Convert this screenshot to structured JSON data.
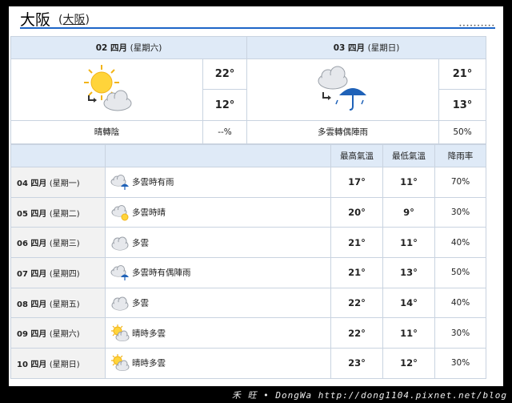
{
  "header": {
    "city": "大阪",
    "sub_open": "(",
    "sub_link": "大阪",
    "sub_close": ")",
    "dots": "••••••••••"
  },
  "days": [
    {
      "date": "02 四月",
      "weekday": "(星期六)",
      "icon": "sun-to-cloud-icon",
      "high": "22°",
      "low": "12°",
      "desc": "晴轉陰",
      "rain": "--%"
    },
    {
      "date": "03 四月",
      "weekday": "(星期日)",
      "icon": "cloud-to-rain-icon",
      "high": "21°",
      "low": "13°",
      "desc": "多雲轉偶陣雨",
      "rain": "50%"
    }
  ],
  "week": {
    "headers": {
      "blank1": "",
      "blank2": "",
      "high": "最高氣溫",
      "low": "最低氣溫",
      "rain": "降雨率"
    },
    "rows": [
      {
        "date": "04 四月",
        "weekday": "(星期一)",
        "icon": "cloud-rain-icon",
        "cond": "多雲時有雨",
        "high": "17°",
        "low": "11°",
        "rain": "70%"
      },
      {
        "date": "05 四月",
        "weekday": "(星期二)",
        "icon": "cloud-sun-icon",
        "cond": "多雲時晴",
        "high": "20°",
        "low": "9°",
        "rain": "30%"
      },
      {
        "date": "06 四月",
        "weekday": "(星期三)",
        "icon": "cloud-icon",
        "cond": "多雲",
        "high": "21°",
        "low": "11°",
        "rain": "40%"
      },
      {
        "date": "07 四月",
        "weekday": "(星期四)",
        "icon": "cloud-rain-icon",
        "cond": "多雲時有偶陣雨",
        "high": "21°",
        "low": "13°",
        "rain": "50%"
      },
      {
        "date": "08 四月",
        "weekday": "(星期五)",
        "icon": "cloud-icon",
        "cond": "多雲",
        "high": "22°",
        "low": "14°",
        "rain": "40%"
      },
      {
        "date": "09 四月",
        "weekday": "(星期六)",
        "icon": "sun-cloud-icon",
        "cond": "晴時多雲",
        "high": "22°",
        "low": "11°",
        "rain": "30%"
      },
      {
        "date": "10 四月",
        "weekday": "(星期日)",
        "icon": "sun-cloud-icon",
        "cond": "晴時多雲",
        "high": "23°",
        "low": "12°",
        "rain": "30%"
      }
    ]
  },
  "colors": {
    "high": "#d0211c",
    "low": "#1f62b8",
    "header_bg": "#dfeaf7",
    "border": "#c9d3e0",
    "rule": "#1e66c8"
  },
  "watermark": "禾 旺 • DongWa http://dong1104.pixnet.net/blog"
}
